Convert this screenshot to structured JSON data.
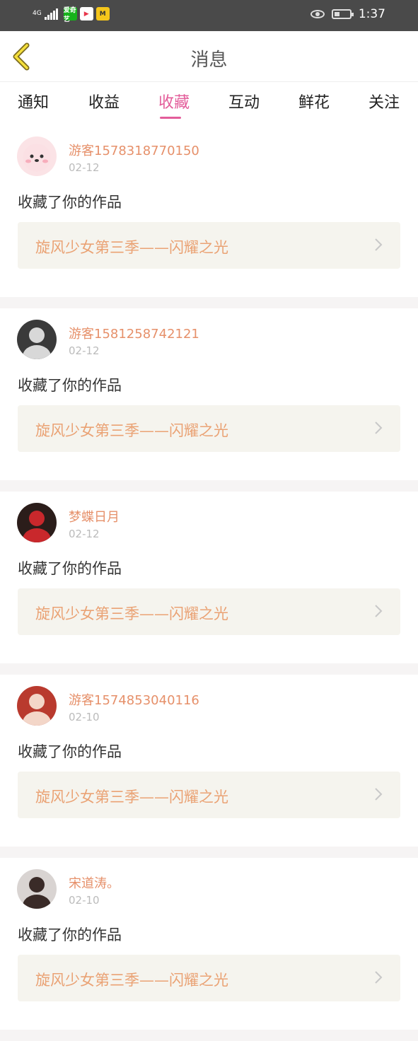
{
  "status_bar": {
    "network": "4G",
    "time": "1:37",
    "apps": [
      {
        "icon": "iqiyi-app-icon",
        "label": "爱奇艺",
        "bg": "#16b31b",
        "fg": "#ffffff"
      },
      {
        "icon": "video-app-icon",
        "label": "▶",
        "bg": "#ffffff",
        "fg": "#e8354b"
      },
      {
        "icon": "m-app-icon",
        "label": "M",
        "bg": "#f5c61b",
        "fg": "#333333"
      }
    ]
  },
  "header": {
    "title": "消息"
  },
  "tabs": [
    {
      "label": "通知",
      "active": false
    },
    {
      "label": "收益",
      "active": false
    },
    {
      "label": "收藏",
      "active": true
    },
    {
      "label": "互动",
      "active": false
    },
    {
      "label": "鲜花",
      "active": false
    },
    {
      "label": "关注",
      "active": false
    }
  ],
  "messages": [
    {
      "user": "游客1578318770150",
      "date": "02-12",
      "action": "收藏了你的作品",
      "work": "旋风少女第三季——闪耀之光",
      "avatar": {
        "bg": "#fbe3e6",
        "fg": "#f3a7b3",
        "icon": "cartoon-avatar"
      }
    },
    {
      "user": "游客1581258742121",
      "date": "02-12",
      "action": "收藏了你的作品",
      "work": "旋风少女第三季——闪耀之光",
      "avatar": {
        "bg": "#3a3a3a",
        "fg": "#d8d8d8",
        "icon": "photo-avatar"
      }
    },
    {
      "user": "梦蝶日月",
      "date": "02-12",
      "action": "收藏了你的作品",
      "work": "旋风少女第三季——闪耀之光",
      "avatar": {
        "bg": "#2b1d1a",
        "fg": "#c9282c",
        "icon": "photo-avatar"
      }
    },
    {
      "user": "游客1574853040116",
      "date": "02-10",
      "action": "收藏了你的作品",
      "work": "旋风少女第三季——闪耀之光",
      "avatar": {
        "bg": "#b93a2e",
        "fg": "#f3d6c8",
        "icon": "photo-avatar"
      }
    },
    {
      "user": "宋道涛。",
      "date": "02-10",
      "action": "收藏了你的作品",
      "work": "旋风少女第三季——闪耀之光",
      "avatar": {
        "bg": "#d9d4d2",
        "fg": "#3a2b28",
        "icon": "photo-avatar"
      }
    }
  ],
  "colors": {
    "accent": "#e35d9a",
    "username": "#e6906a",
    "work_title": "#eaa274",
    "card_bg": "#f5f4ee"
  }
}
